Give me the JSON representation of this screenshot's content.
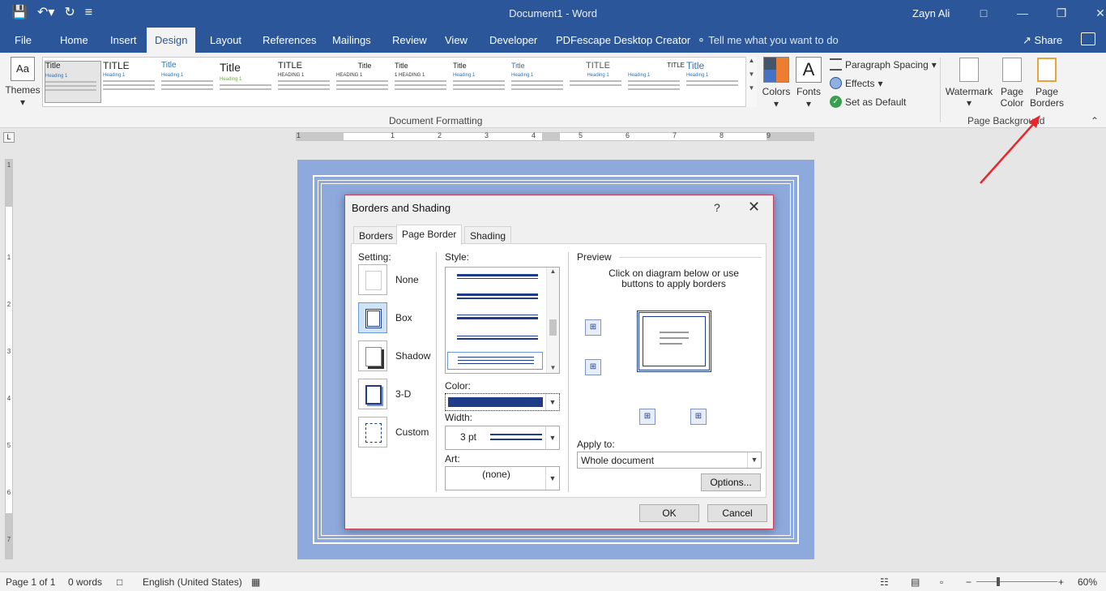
{
  "titlebar": {
    "doc_title": "Document1  -  Word",
    "user_name": "Zayn Ali",
    "save_icon": "save-icon",
    "undo_icon": "undo-icon",
    "redo_icon": "redo-icon",
    "customize_icon": "customize-qat-icon"
  },
  "tabs": [
    {
      "label": "File"
    },
    {
      "label": "Home"
    },
    {
      "label": "Insert"
    },
    {
      "label": "Design"
    },
    {
      "label": "Layout"
    },
    {
      "label": "References"
    },
    {
      "label": "Mailings"
    },
    {
      "label": "Review"
    },
    {
      "label": "View"
    },
    {
      "label": "Developer"
    },
    {
      "label": "PDFescape Desktop Creator"
    }
  ],
  "tell_me": "Tell me what you want to do",
  "share_label": "Share",
  "ribbon": {
    "themes_label": "Themes",
    "style_gallery": [
      {
        "title": "Title",
        "heading": "Heading 1"
      },
      {
        "title": "TITLE",
        "heading": "Heading 1"
      },
      {
        "title": "Title",
        "heading": "Heading 1"
      },
      {
        "title": "Title",
        "heading": "Heading 1"
      },
      {
        "title": "TITLE",
        "heading": "HEADING 1"
      },
      {
        "title": "Title",
        "heading": "HEADING 1"
      },
      {
        "title": "Title",
        "heading": "1  HEADING 1"
      },
      {
        "title": "Title",
        "heading": "Heading 1"
      },
      {
        "title": "Title",
        "heading": "Heading 1"
      },
      {
        "title": "TITLE",
        "heading": "Heading 1"
      },
      {
        "title": "TITLE",
        "heading": "Heading 1"
      },
      {
        "title": "Title",
        "heading": "Heading 1"
      }
    ],
    "document_formatting_label": "Document Formatting",
    "colors_label": "Colors",
    "fonts_label": "Fonts",
    "fonts_glyph": "A",
    "paragraph_spacing_label": "Paragraph Spacing",
    "effects_label": "Effects",
    "set_default_label": "Set as Default",
    "watermark_label": "Watermark",
    "page_color_label_1": "Page",
    "page_color_label_2": "Color",
    "page_borders_label_1": "Page",
    "page_borders_label_2": "Borders",
    "page_background_label": "Page Background"
  },
  "ruler": {
    "h_numbers": [
      "1",
      "1",
      "2",
      "3",
      "4",
      "5",
      "6",
      "7",
      "8",
      "9"
    ],
    "v_numbers": [
      "1",
      "1",
      "2",
      "3",
      "4",
      "5",
      "6",
      "7"
    ]
  },
  "dialog": {
    "title": "Borders and Shading",
    "help": "?",
    "close": "✕",
    "tabs": [
      {
        "label": "Borders"
      },
      {
        "label": "Page Border"
      },
      {
        "label": "Shading"
      }
    ],
    "setting_label": "Setting:",
    "settings": [
      {
        "label": "None"
      },
      {
        "label": "Box"
      },
      {
        "label": "Shadow"
      },
      {
        "label": "3-D"
      },
      {
        "label": "Custom"
      }
    ],
    "style_label": "Style:",
    "color_label": "Color:",
    "color_value": "#1f3c88",
    "width_label": "Width:",
    "width_value": "3 pt",
    "art_label": "Art:",
    "art_value": "(none)",
    "preview_label": "Preview",
    "preview_hint": "Click on diagram below or use buttons to apply borders",
    "apply_to_label": "Apply to:",
    "apply_to_value": "Whole document",
    "options_label": "Options...",
    "ok_label": "OK",
    "cancel_label": "Cancel"
  },
  "status": {
    "page": "Page 1 of 1",
    "words": "0 words",
    "language": "English (United States)",
    "zoom": "60%"
  },
  "colors": {
    "accent": "#2b579a",
    "page_bg": "#8ea9dc",
    "border_blue": "#1f3c88",
    "arrow": "#e8262c"
  }
}
